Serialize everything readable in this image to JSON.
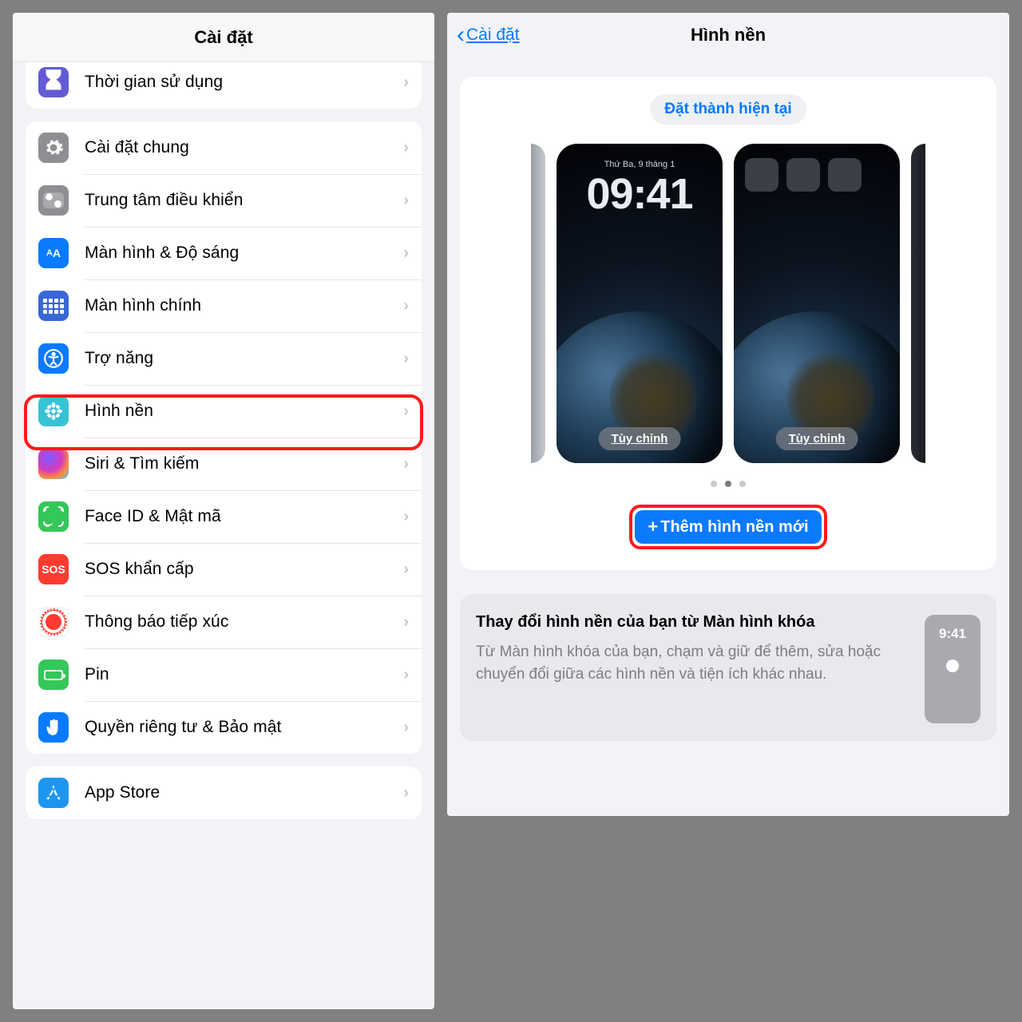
{
  "left": {
    "title": "Cài đặt",
    "partial_row": "Thời gian sử dụng",
    "group2": [
      {
        "id": "general",
        "label": "Cài đặt chung"
      },
      {
        "id": "control",
        "label": "Trung tâm điều khiển"
      },
      {
        "id": "display",
        "label": "Màn hình & Độ sáng"
      },
      {
        "id": "home",
        "label": "Màn hình chính"
      },
      {
        "id": "acc",
        "label": "Trợ năng"
      },
      {
        "id": "wall",
        "label": "Hình nền"
      },
      {
        "id": "siri",
        "label": "Siri & Tìm kiếm"
      },
      {
        "id": "face",
        "label": "Face ID & Mật mã"
      },
      {
        "id": "sos",
        "label": "SOS khẩn cấp",
        "txt": "SOS"
      },
      {
        "id": "exp",
        "label": "Thông báo tiếp xúc"
      },
      {
        "id": "bat",
        "label": "Pin"
      },
      {
        "id": "priv",
        "label": "Quyền riêng tư & Bảo mật"
      }
    ],
    "group3": [
      {
        "id": "appstore",
        "label": "App Store"
      }
    ]
  },
  "right": {
    "back": "Cài đặt",
    "title": "Hình nền",
    "set_current": "Đặt thành hiện tại",
    "lock_date": "Thứ Ba, 9 tháng 1",
    "lock_time": "09:41",
    "customize": "Tùy chỉnh",
    "add_new": "Thêm hình nền mới",
    "tip_title": "Thay đổi hình nền của bạn từ Màn hình khóa",
    "tip_body": "Từ Màn hình khóa của bạn, chạm và giữ để thêm, sửa hoặc chuyển đổi giữa các hình nền và tiện ích khác nhau.",
    "tip_time": "9:41"
  }
}
